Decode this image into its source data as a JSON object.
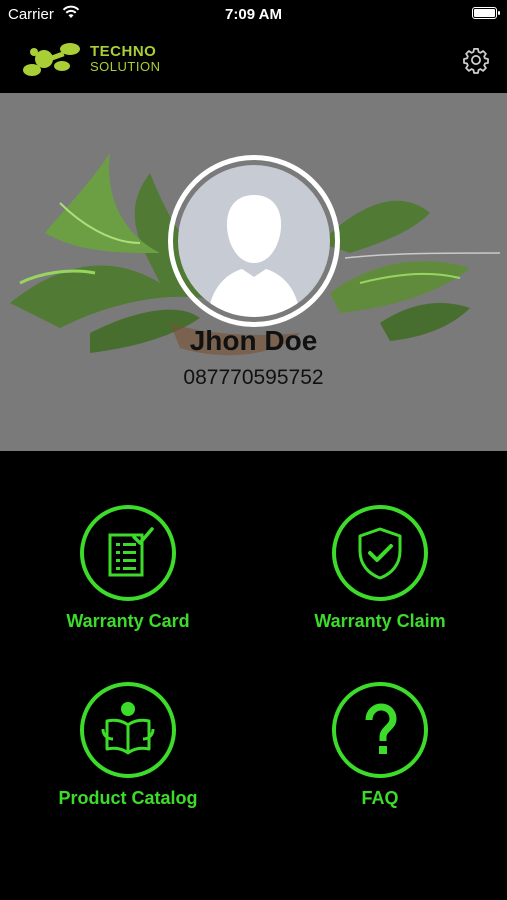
{
  "status_bar": {
    "carrier": "Carrier",
    "time": "7:09 AM",
    "wifi_icon": "wifi-icon",
    "battery_icon": "battery-icon"
  },
  "nav_bar": {
    "logo_icon": "techno-solution-logo",
    "brand_line1": "TECHNO",
    "brand_line2": "SOLUTION",
    "settings_icon": "gear-icon"
  },
  "profile": {
    "name": "Jhon Doe",
    "phone": "087770595752",
    "avatar_icon": "default-avatar-icon"
  },
  "menu": {
    "items": [
      {
        "label": "Warranty Card",
        "icon": "warranty-card-icon"
      },
      {
        "label": "Warranty Claim",
        "icon": "shield-check-icon"
      },
      {
        "label": "Product Catalog",
        "icon": "reading-person-icon"
      },
      {
        "label": "FAQ",
        "icon": "question-mark-icon"
      }
    ]
  },
  "colors": {
    "accent_green": "#3ddc2a",
    "brand_green": "#a9cf36",
    "background": "#000000",
    "hero_gray": "#7a7a7a"
  }
}
